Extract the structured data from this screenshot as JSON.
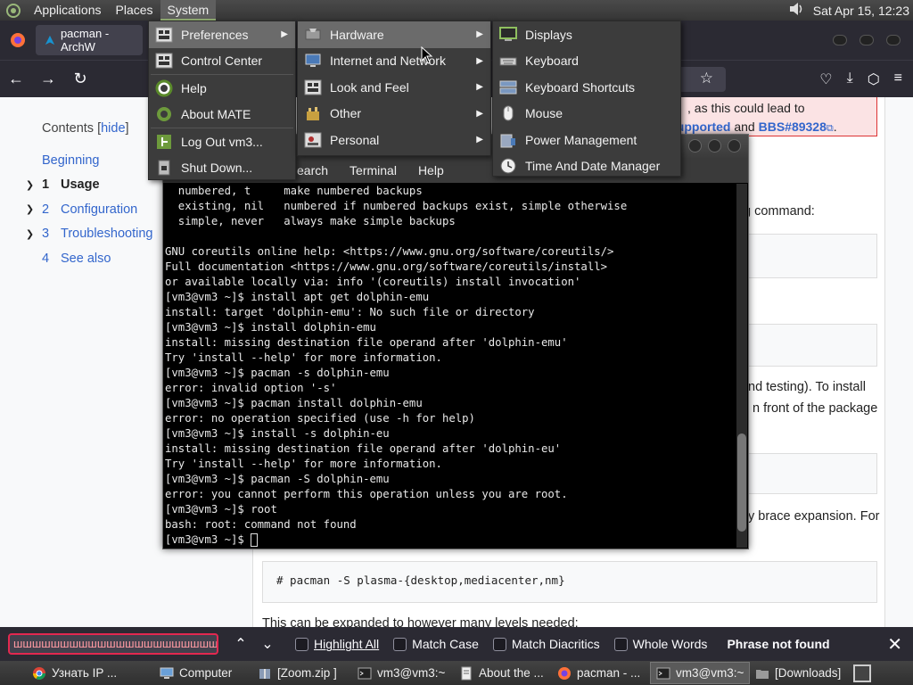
{
  "top_panel": {
    "menus": [
      "Applications",
      "Places",
      "System"
    ],
    "active_menu": "System",
    "clock": "Sat Apr 15, 12:23"
  },
  "browser": {
    "tab_title": "pacman - ArchW",
    "toc": {
      "title": "Contents",
      "hide_label": "hide",
      "items": [
        {
          "num": "",
          "label": "Beginning",
          "chevron": false
        },
        {
          "num": "1",
          "label": "Usage",
          "chevron": true,
          "current": true
        },
        {
          "num": "2",
          "label": "Configuration",
          "chevron": true
        },
        {
          "num": "3",
          "label": "Troubleshooting",
          "chevron": true
        },
        {
          "num": "4",
          "label": "See also",
          "chevron": false
        }
      ]
    },
    "article": {
      "warn_line1": ", as this could lead to",
      "warn_link1": "supported",
      "warn_and": "and",
      "warn_link2": "BBS#89328",
      "frag_command": "g command:",
      "frag_testing": "nd testing). To install",
      "frag_front": "n front of the package",
      "frag_brace": "y brace expansion. For",
      "code_plasma": "# pacman -S plasma-{desktop,mediacenter,nm}",
      "expanded_text": "This can be expanded to however many levels needed:"
    }
  },
  "find_bar": {
    "query": "шшшшшшшшшшшшшшшшшшшшшшшшшшшшшшш",
    "options": [
      "Highlight All",
      "Match Case",
      "Match Diacritics",
      "Whole Words"
    ],
    "status": "Phrase not found"
  },
  "taskbar": {
    "items": [
      {
        "label": "Узнать IP ...",
        "icon": "chrome-icon"
      },
      {
        "label": "Computer",
        "icon": "computer-icon"
      },
      {
        "label": "[Zoom.zip ]",
        "icon": "archive-icon"
      },
      {
        "label": "vm3@vm3:~",
        "icon": "terminal-icon"
      },
      {
        "label": "About the ...",
        "icon": "document-icon"
      },
      {
        "label": "pacman - ...",
        "icon": "firefox-icon"
      },
      {
        "label": "vm3@vm3:~",
        "icon": "terminal-icon",
        "active": true
      },
      {
        "label": "[Downloads]",
        "icon": "folder-icon"
      }
    ]
  },
  "terminal": {
    "menu": [
      "earch",
      "Terminal",
      "Help"
    ],
    "lines": [
      "  numbered, t     make numbered backups",
      "  existing, nil   numbered if numbered backups exist, simple otherwise",
      "  simple, never   always make simple backups",
      "",
      "GNU coreutils online help: <https://www.gnu.org/software/coreutils/>",
      "Full documentation <https://www.gnu.org/software/coreutils/install>",
      "or available locally via: info '(coreutils) install invocation'",
      "[vm3@vm3 ~]$ install apt get dolphin-emu",
      "install: target 'dolphin-emu': No such file or directory",
      "[vm3@vm3 ~]$ install dolphin-emu",
      "install: missing destination file operand after 'dolphin-emu'",
      "Try 'install --help' for more information.",
      "[vm3@vm3 ~]$ pacman -s dolphin-emu",
      "error: invalid option '-s'",
      "[vm3@vm3 ~]$ pacman install dolphin-emu",
      "error: no operation specified (use -h for help)",
      "[vm3@vm3 ~]$ install -s dolphin-eu",
      "install: missing destination file operand after 'dolphin-eu'",
      "Try 'install --help' for more information.",
      "[vm3@vm3 ~]$ pacman -S dolphin-emu",
      "error: you cannot perform this operation unless you are root.",
      "[vm3@vm3 ~]$ root",
      "bash: root: command not found"
    ],
    "prompt": "[vm3@vm3 ~]$ "
  },
  "system_menu": {
    "items": [
      "Preferences",
      "Control Center",
      "Help",
      "About MATE",
      "Log Out vm3...",
      "Shut Down..."
    ]
  },
  "preferences_menu": {
    "items": [
      "Hardware",
      "Internet and Network",
      "Look and Feel",
      "Other",
      "Personal"
    ]
  },
  "hardware_menu": {
    "items": [
      "Displays",
      "Keyboard",
      "Keyboard Shortcuts",
      "Mouse",
      "Power Management",
      "Time And Date Manager"
    ]
  }
}
